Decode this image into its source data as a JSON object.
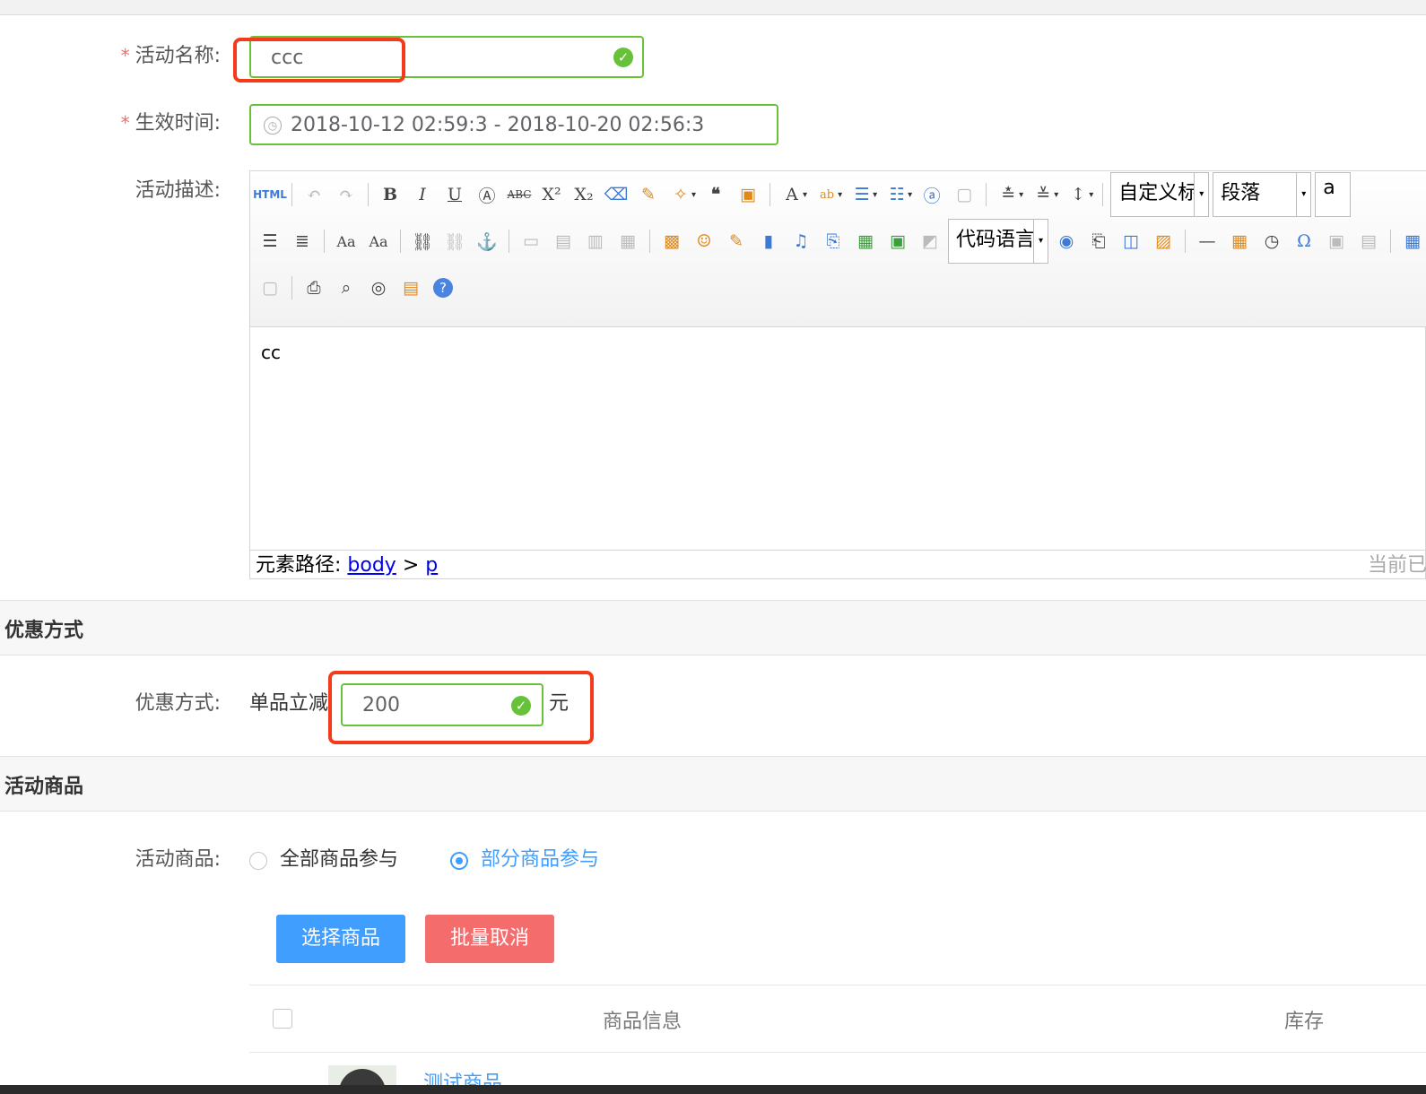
{
  "form": {
    "name_label": "活动名称:",
    "name_value": "ccc",
    "time_label": "生效时间:",
    "time_value": "2018-10-12 02:59:3 - 2018-10-20 02:56:3",
    "desc_label": "活动描述:",
    "required_mark": "*"
  },
  "editor": {
    "custom_title_combo": "自定义标",
    "paragraph_combo": "段落",
    "font_combo": "a",
    "code_lang_combo": "代码语言",
    "body_text": "cc",
    "path_label": "元素路径:",
    "path_body": "body",
    "path_sep": ">",
    "path_p": "p",
    "count_text": "当前已"
  },
  "discount": {
    "section_title": "优惠方式",
    "label": "优惠方式:",
    "prefix": "单品立减",
    "value": "200",
    "unit": "元"
  },
  "goods": {
    "section_title": "活动商品",
    "label": "活动商品:",
    "radio_all": "全部商品参与",
    "radio_partial": "部分商品参与",
    "select_button": "选择商品",
    "cancel_button": "批量取消",
    "col_info": "商品信息",
    "col_stock": "库存",
    "product_name": "测试商品"
  },
  "colors": {
    "success": "#67c23a",
    "primary": "#409eff",
    "danger": "#f56c6c",
    "highlight": "#f33b1b"
  }
}
